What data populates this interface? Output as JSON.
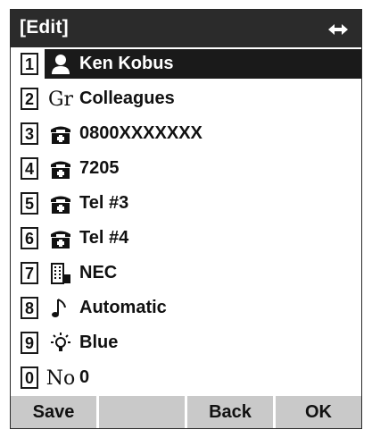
{
  "header": {
    "title": "[Edit]",
    "nav_icon": "up-down-arrow-icon"
  },
  "entries": [
    {
      "num": "1",
      "icon": "person-icon",
      "label": "Ken Kobus",
      "selected": true
    },
    {
      "num": "2",
      "icon": "group-gr-icon",
      "icon_text": "Gr",
      "label": "Colleagues"
    },
    {
      "num": "3",
      "icon": "telephone-icon",
      "label": "0800XXXXXXX"
    },
    {
      "num": "4",
      "icon": "telephone-icon",
      "label": "7205"
    },
    {
      "num": "5",
      "icon": "telephone-icon",
      "label": "Tel #3"
    },
    {
      "num": "6",
      "icon": "telephone-icon",
      "label": "Tel #4"
    },
    {
      "num": "7",
      "icon": "building-icon",
      "label": "NEC"
    },
    {
      "num": "8",
      "icon": "music-note-icon",
      "label": "Automatic"
    },
    {
      "num": "9",
      "icon": "lamp-icon",
      "label": "Blue"
    },
    {
      "num": "0",
      "icon": "number-no-icon",
      "icon_text": "No",
      "label": "0"
    }
  ],
  "softkeys": [
    "Save",
    "",
    "Back",
    "OK"
  ],
  "colors": {
    "titlebar": "#2b2b2b",
    "selection": "#1a1a1a",
    "softkey": "#c9c9c9"
  }
}
